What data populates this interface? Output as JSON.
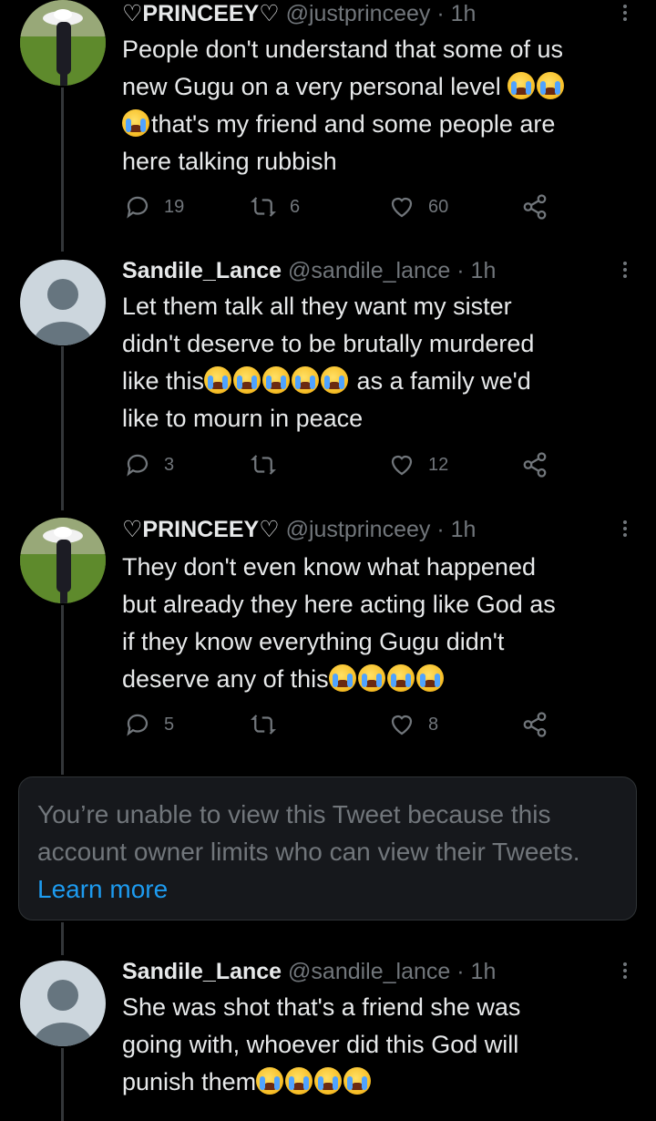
{
  "tweets": [
    {
      "name": "♡PRINCEEY♡",
      "handle": "@justprinceey",
      "time": "· 1h",
      "avatar": "photo",
      "lines": [
        "People don't understand that some of us",
        "new Gugu on a very personal level",
        "that's my friend and some people are",
        "here talking rubbish"
      ],
      "emoji_after_line": [
        0,
        2,
        1,
        0
      ],
      "emoji_before_line": [
        0,
        0,
        1,
        0
      ],
      "replies": "19",
      "retweets": "6",
      "likes": "60"
    },
    {
      "name": "Sandile_Lance",
      "handle": "@sandile_lance",
      "time": "· 1h",
      "avatar": "default",
      "lines": [
        "Let them talk all they want my sister",
        "didn't deserve to be brutally murdered",
        "like this",
        "as a family we'd",
        "like to mourn in peace"
      ],
      "replies": "3",
      "retweets": "",
      "likes": "12"
    },
    {
      "name": "♡PRINCEEY♡",
      "handle": "@justprinceey",
      "time": "· 1h",
      "avatar": "photo",
      "lines": [
        "They don't even know what happened",
        "but already they here acting like God as",
        "if they know everything Gugu didn't",
        "deserve any of this"
      ],
      "replies": "5",
      "retweets": "",
      "likes": "8"
    },
    {
      "name": "Sandile_Lance",
      "handle": "@sandile_lance",
      "time": "· 1h",
      "avatar": "default",
      "lines": [
        "She was shot that's a friend she was",
        "going with, whoever did this God will",
        "punish them"
      ]
    }
  ],
  "withheld": {
    "text": "You’re unable to view this Tweet because this account owner limits who can view their Tweets.",
    "link": "Learn more"
  },
  "icons": {
    "reply": "reply-icon",
    "retweet": "retweet-icon",
    "like": "heart-icon",
    "share": "share-icon",
    "more": "more-icon",
    "emoji": "loudly-crying-face-emoji"
  },
  "colors": {
    "background": "#000000",
    "text": "#e7e9ea",
    "muted": "#71767b",
    "link": "#1d9bf0",
    "card": "#16181c"
  }
}
